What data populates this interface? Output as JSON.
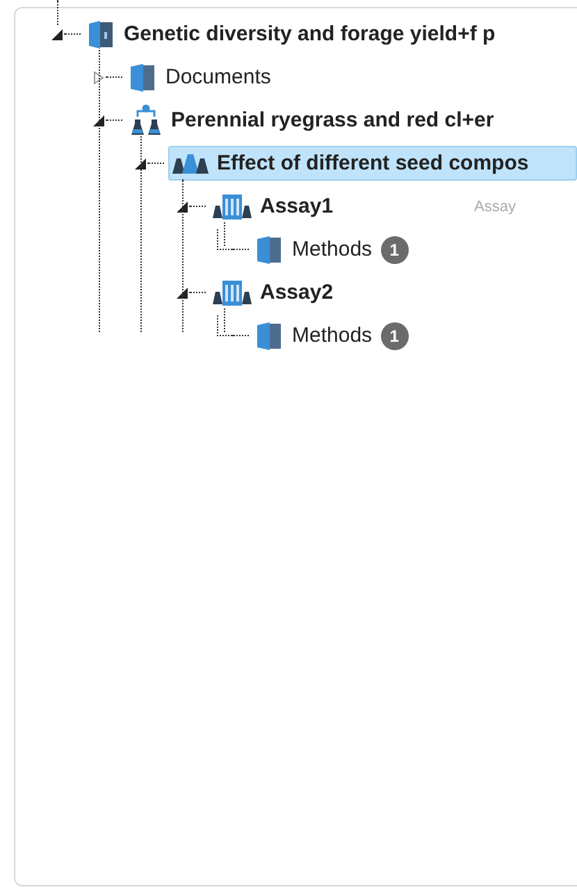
{
  "tree": [
    {
      "kind": "investigation",
      "label": "Genetic diversity and forage yield+f p",
      "bold": true,
      "expanded": true,
      "selected": false,
      "children": [
        {
          "kind": "folder",
          "label": "Documents",
          "bold": false,
          "expanded": false,
          "selected": false
        },
        {
          "kind": "study_group",
          "label": "Perennial ryegrass and red cl+er",
          "bold": true,
          "expanded": true,
          "selected": false,
          "children": [
            {
              "kind": "study",
              "label": "Effect of different seed compos",
              "bold": true,
              "expanded": true,
              "selected": true,
              "children": [
                {
                  "kind": "assay",
                  "label": "Assay1",
                  "bold": true,
                  "expanded": true,
                  "selected": false,
                  "type_label": "Assay",
                  "children": [
                    {
                      "kind": "folder",
                      "label": "Methods",
                      "bold": false,
                      "selected": false,
                      "badge": "1"
                    }
                  ]
                },
                {
                  "kind": "assay",
                  "label": "Assay2",
                  "bold": true,
                  "expanded": true,
                  "selected": false,
                  "children": [
                    {
                      "kind": "folder",
                      "label": "Methods",
                      "bold": false,
                      "selected": false,
                      "badge": "1"
                    }
                  ]
                }
              ]
            }
          ]
        }
      ]
    }
  ]
}
